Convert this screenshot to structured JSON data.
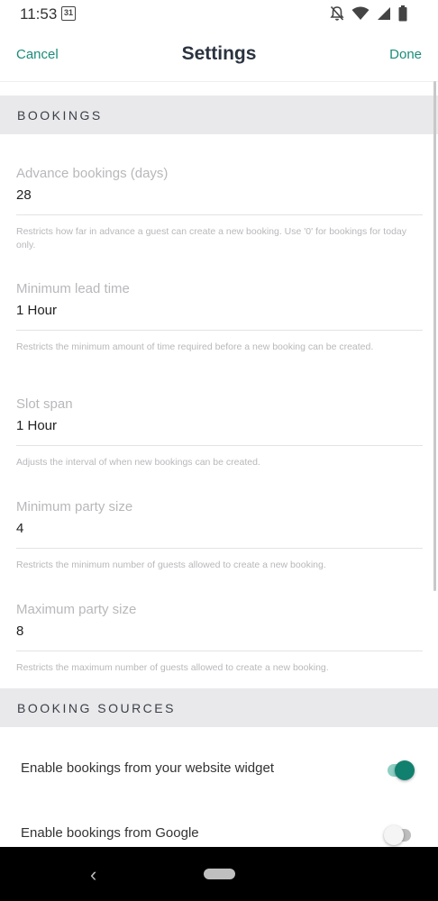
{
  "status_bar": {
    "time": "11:53",
    "calendar_day": "31"
  },
  "header": {
    "cancel": "Cancel",
    "title": "Settings",
    "done": "Done"
  },
  "sections": {
    "bookings": {
      "title": "BOOKINGS"
    },
    "booking_sources": {
      "title": "BOOKING SOURCES"
    }
  },
  "fields": [
    {
      "label": "Advance bookings (days)",
      "value": "28",
      "help": "Restricts how far in advance a guest can create a new booking. Use '0' for bookings for today only."
    },
    {
      "label": "Minimum lead time",
      "value": "1 Hour",
      "help": "Restricts the minimum amount of time required before a new booking can be created."
    },
    {
      "label": "Slot span",
      "value": "1 Hour",
      "help": "Adjusts the interval of when new bookings can be created."
    },
    {
      "label": "Minimum party size",
      "value": "4",
      "help": "Restricts the minimum number of guests allowed to create a new booking."
    },
    {
      "label": "Maximum party size",
      "value": "8",
      "help": "Restricts the maximum number of guests allowed to create a new booking."
    }
  ],
  "toggles": [
    {
      "label": "Enable bookings from your website widget",
      "on": true
    },
    {
      "label": "Enable bookings from Google",
      "on": false
    }
  ],
  "colors": {
    "accent": "#1a8c7a",
    "toggle_on_knob": "#11806f",
    "toggle_on_track": "#8fcfc4",
    "toggle_off_knob": "#f5f5f5",
    "toggle_off_track": "#bdbdbd"
  }
}
